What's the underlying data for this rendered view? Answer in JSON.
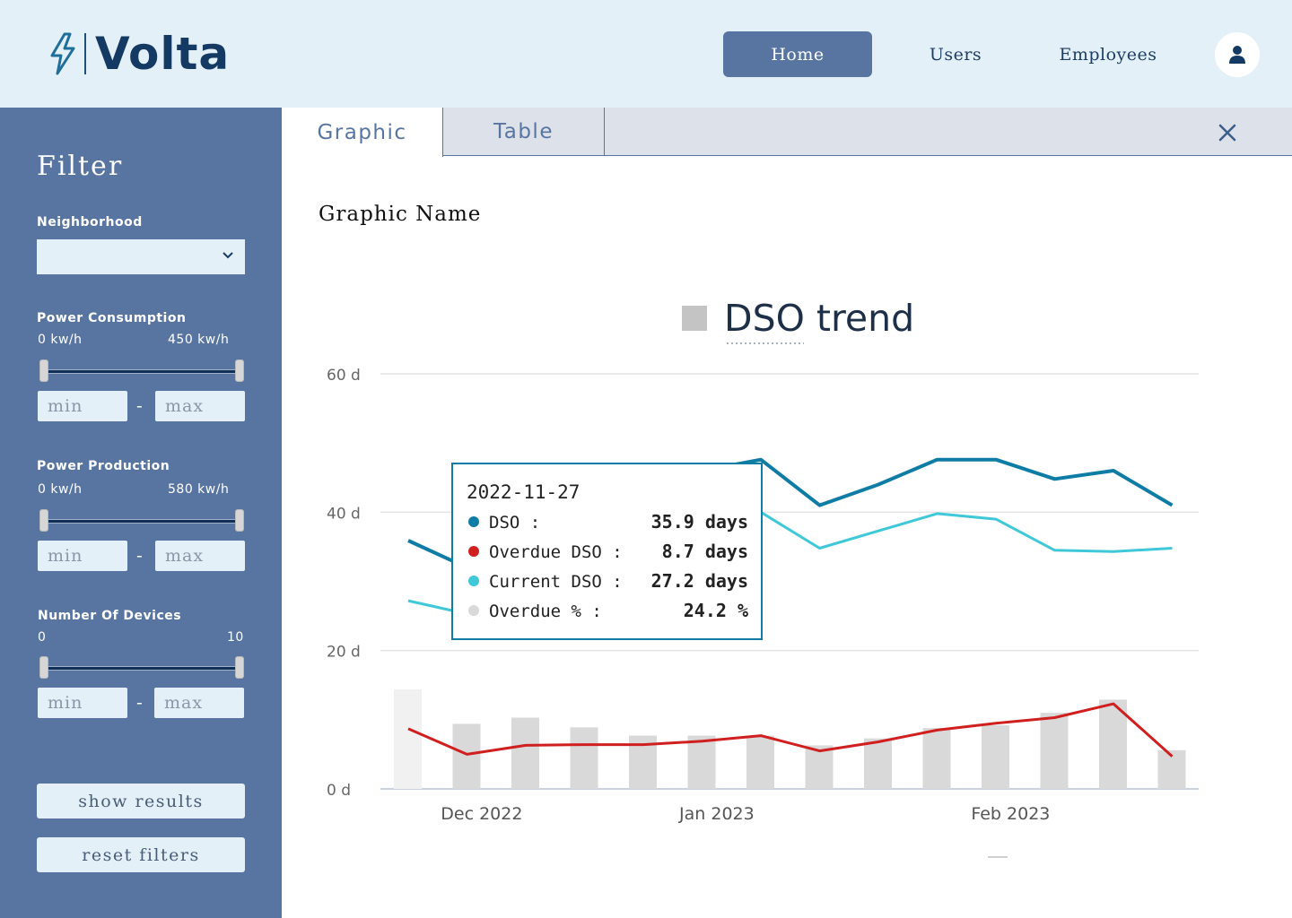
{
  "header": {
    "brand": "Volta",
    "nav": [
      {
        "label": "Home",
        "active": true
      },
      {
        "label": "Users",
        "active": false
      },
      {
        "label": "Employees",
        "active": false
      }
    ],
    "avatar_icon": "user-icon",
    "colors": {
      "header_bg": "#e3f0f8",
      "brand": "#143a63",
      "active_nav": "#5875a2"
    }
  },
  "sidebar": {
    "title": "Filter",
    "neighborhood": {
      "label": "Neighborhood",
      "value": ""
    },
    "power_consumption": {
      "label": "Power Consumption",
      "min_label": "0 kw/h",
      "max_label": "450 kw/h",
      "min_placeholder": "min",
      "max_placeholder": "max"
    },
    "power_production": {
      "label": "Power Production",
      "min_label": "0 kw/h",
      "max_label": "580 kw/h",
      "min_placeholder": "min",
      "max_placeholder": "max"
    },
    "devices": {
      "label": "Number Of Devices",
      "min_label": "0",
      "max_label": "10",
      "min_placeholder": "min",
      "max_placeholder": "max"
    },
    "range_separator": "-",
    "show_results": "show results",
    "reset_filters": "reset filters",
    "colors": {
      "sidebar_bg": "#5875a2",
      "field_bg": "#e3f0f8"
    }
  },
  "main": {
    "tabs": [
      {
        "label": "Graphic",
        "active": true
      },
      {
        "label": "Table",
        "active": false
      }
    ],
    "close_icon": "close-icon",
    "graphic_name": "Graphic Name"
  },
  "chart_data": {
    "type": "line",
    "title": "DSO trend",
    "y_ticks": [
      "0 d",
      "20 d",
      "40 d",
      "60 d"
    ],
    "ylim": [
      0,
      60
    ],
    "x_tick_labels": [
      {
        "label": "Dec 2022",
        "index": 1.25
      },
      {
        "label": "Jan 2023",
        "index": 5.25
      },
      {
        "label": "Feb 2023",
        "index": 10.25
      }
    ],
    "grid": true,
    "series": [
      {
        "name": "DSO",
        "color": "#0e7ca5",
        "kind": "line",
        "values": [
          35.9,
          32.0,
          34.0,
          37.0,
          42.0,
          46.0,
          47.6,
          41.0,
          44.0,
          47.6,
          47.6,
          44.8,
          46.0,
          41.0
        ]
      },
      {
        "name": "Overdue DSO",
        "color": "#d01f1f",
        "kind": "line",
        "values": [
          8.7,
          5.0,
          6.3,
          6.4,
          6.4,
          6.9,
          7.7,
          5.5,
          6.8,
          8.5,
          9.5,
          10.3,
          12.3,
          4.7
        ]
      },
      {
        "name": "Current DSO",
        "color": "#3ec8d8",
        "kind": "line",
        "values": [
          27.2,
          25.3,
          27.0,
          31.0,
          35.0,
          37.5,
          40.0,
          34.8,
          37.3,
          39.8,
          39.0,
          34.5,
          34.3,
          34.8
        ]
      },
      {
        "name": "Overdue %",
        "color": "#d9d9d9",
        "kind": "bar",
        "values": [
          14.4,
          9.4,
          10.3,
          8.9,
          7.7,
          7.7,
          7.7,
          6.3,
          7.3,
          8.8,
          9.2,
          11.0,
          12.9,
          5.6
        ]
      }
    ],
    "tooltip": {
      "date": "2022-11-27",
      "rows": [
        {
          "label": "DSO :",
          "value": "35.9 days",
          "color": "#0e7ca5"
        },
        {
          "label": "Overdue DSO :",
          "value": "8.7 days",
          "color": "#d01f1f"
        },
        {
          "label": "Current DSO :",
          "value": "27.2 days",
          "color": "#3ec8d8"
        },
        {
          "label": "Overdue % :",
          "value": "24.2 %",
          "color": "#d9d9d9"
        }
      ]
    }
  }
}
